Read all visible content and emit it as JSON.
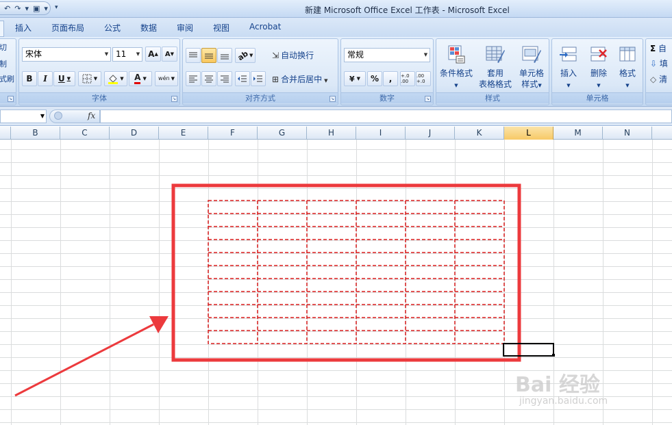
{
  "window": {
    "title": "新建 Microsoft Office Excel 工作表 - Microsoft Excel"
  },
  "tabs": [
    "插入",
    "页面布局",
    "公式",
    "数据",
    "审阅",
    "视图",
    "Acrobat"
  ],
  "clipboard_partial": {
    "line1": "切",
    "line2": "制",
    "line3": "式刷"
  },
  "font_group": {
    "font_name": "宋体",
    "font_size": "11",
    "grow": "A",
    "shrink": "A",
    "bold": "B",
    "italic": "I",
    "underline": "U",
    "color_letter": "A",
    "phonetic": "wén",
    "label": "字体"
  },
  "alignment_group": {
    "wrap_text": "自动换行",
    "merge_center": "合并后居中",
    "label": "对齐方式"
  },
  "number_group": {
    "format": "常规",
    "percent": "%",
    "comma": ",",
    "inc_decimal": "+.0 .00",
    "dec_decimal": ".00 +.0",
    "label": "数字"
  },
  "styles_group": {
    "conditional": "条件格式",
    "table_line1": "套用",
    "table_line2": "表格格式",
    "cell_line1": "单元格",
    "cell_line2": "样式",
    "label": "样式"
  },
  "cells_group": {
    "insert": "插入",
    "delete": "删除",
    "format": "格式",
    "label": "单元格"
  },
  "editing_partial": {
    "sum": "自",
    "fill": "填",
    "clear": "清"
  },
  "formula_bar": {
    "fx": "fx"
  },
  "columns": [
    "B",
    "C",
    "D",
    "E",
    "F",
    "G",
    "H",
    "I",
    "J",
    "K",
    "L",
    "M",
    "N"
  ],
  "selected_column": "L",
  "watermark": {
    "main": "Bai 经验",
    "url": "jingyan.baidu.com"
  },
  "colors": {
    "annotation_red": "#e8262b",
    "cell_border_red": "#d81c1c",
    "selected_header": "#f7c966"
  }
}
